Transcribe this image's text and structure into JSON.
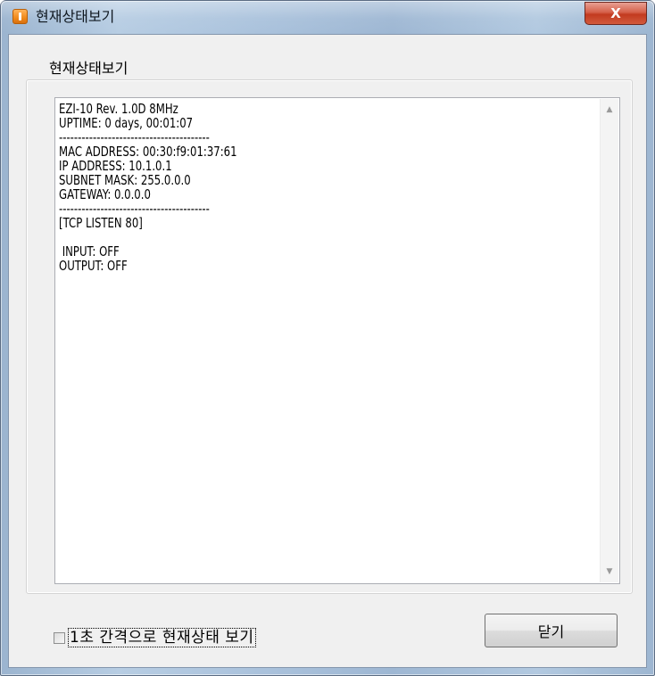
{
  "window": {
    "title": "현재상태보기",
    "close_glyph": "X"
  },
  "group": {
    "label": "현재상태보기"
  },
  "status_text": {
    "lines": [
      "EZI-10 Rev. 1.0D 8MHz",
      "UPTIME: 0 days, 00:01:07",
      "----------------------------------------",
      "MAC ADDRESS: 00:30:f9:01:37:61",
      "IP ADDRESS: 10.1.0.1",
      "SUBNET MASK: 255.0.0.0",
      "GATEWAY: 0.0.0.0",
      "----------------------------------------",
      "[TCP LISTEN 80]",
      "",
      " INPUT: OFF",
      "OUTPUT: OFF"
    ]
  },
  "scrollbar": {
    "up_glyph": "▲",
    "down_glyph": "▼"
  },
  "options": {
    "auto_refresh_label": "1초 간격으로 현재상태 보기",
    "auto_refresh_checked": false
  },
  "buttons": {
    "close_label": "닫기"
  }
}
